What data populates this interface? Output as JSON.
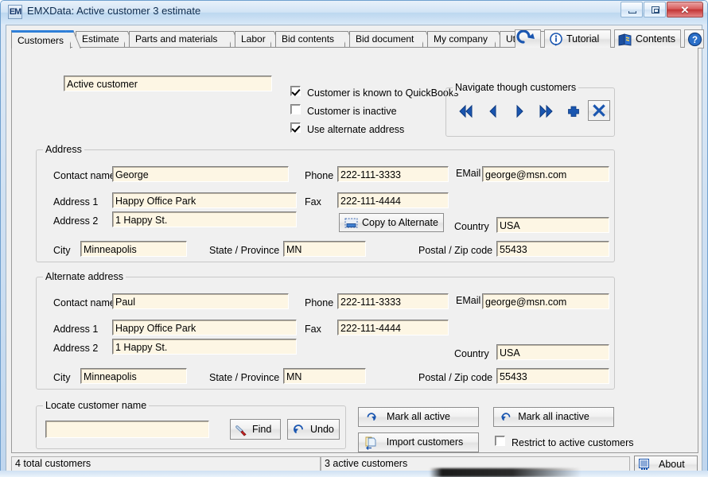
{
  "window": {
    "app_icon_text": "EM",
    "title": "EMXData:  Active customer 3 estimate",
    "minimize_label": "minimize",
    "maximize_label": "maximize",
    "close_label": "✕"
  },
  "tabs": [
    {
      "label": "Customers",
      "active": true
    },
    {
      "label": "Estimate",
      "active": false
    },
    {
      "label": "Parts and materials",
      "active": false
    },
    {
      "label": "Labor",
      "active": false
    },
    {
      "label": "Bid contents",
      "active": false
    },
    {
      "label": "Bid document",
      "active": false
    },
    {
      "label": "My company",
      "active": false
    },
    {
      "label": "Utilities",
      "active": false
    }
  ],
  "toolbar": {
    "refresh_label": "",
    "tutorial_label": "Tutorial",
    "contents_label": "Contents",
    "help_label": ""
  },
  "customer": {
    "name_value": "Active customer",
    "known_to_quickbooks": {
      "label": "Customer is known to QuickBooks",
      "checked": true
    },
    "is_inactive": {
      "label": "Customer is inactive",
      "checked": false
    },
    "use_alternate_address": {
      "label": "Use alternate address",
      "checked": true
    }
  },
  "navigate": {
    "title": "Navigate though customers",
    "first_label": "first",
    "previous_label": "previous",
    "next_label": "next",
    "last_label": "last",
    "add_label": "add",
    "delete_label": "delete"
  },
  "address": {
    "title": "Address",
    "contact_name_label": "Contact name",
    "contact_name_value": "George",
    "address1_label": "Address 1",
    "address1_value": "Happy Office Park",
    "address2_label": "Address 2",
    "address2_value": "1 Happy St.",
    "city_label": "City",
    "city_value": "Minneapolis",
    "state_label": "State / Province",
    "state_value": "MN",
    "phone_label": "Phone",
    "phone_value": "222-111-3333",
    "fax_label": "Fax",
    "fax_value": "222-111-4444",
    "email_label": "EMail",
    "email_value": "george@msn.com",
    "country_label": "Country",
    "country_value": "USA",
    "postal_label": "Postal / Zip code",
    "postal_value": "55433",
    "copy_button_label": "Copy to Alternate"
  },
  "alternate_address": {
    "title": "Alternate address",
    "contact_name_label": "Contact name",
    "contact_name_value": "Paul",
    "address1_label": "Address 1",
    "address1_value": "Happy Office Park",
    "address2_label": "Address 2",
    "address2_value": "1 Happy St.",
    "city_label": "City",
    "city_value": "Minneapolis",
    "state_label": "State / Province",
    "state_value": "MN",
    "phone_label": "Phone",
    "phone_value": "222-111-3333",
    "fax_label": "Fax",
    "fax_value": "222-111-4444",
    "email_label": "EMail",
    "email_value": "george@msn.com",
    "country_label": "Country",
    "country_value": "USA",
    "postal_label": "Postal / Zip code",
    "postal_value": "55433"
  },
  "locate": {
    "title": "Locate customer name",
    "search_value": "",
    "find_label": "Find",
    "undo_label": "Undo"
  },
  "actions": {
    "mark_all_active_label": "Mark all active",
    "mark_all_inactive_label": "Mark all inactive",
    "import_customers_label": "Import customers",
    "restrict_label": "Restrict to active customers",
    "restrict_checked": false
  },
  "statusbar": {
    "total_customers": "4 total customers",
    "active_customers": "3 active customers",
    "about_label": "About"
  },
  "colors": {
    "accent_blue": "#1a56b0",
    "active_tab": "#2f7fd8",
    "field_bg": "#fdf6e4",
    "panel_bg": "#f0f0f0"
  }
}
